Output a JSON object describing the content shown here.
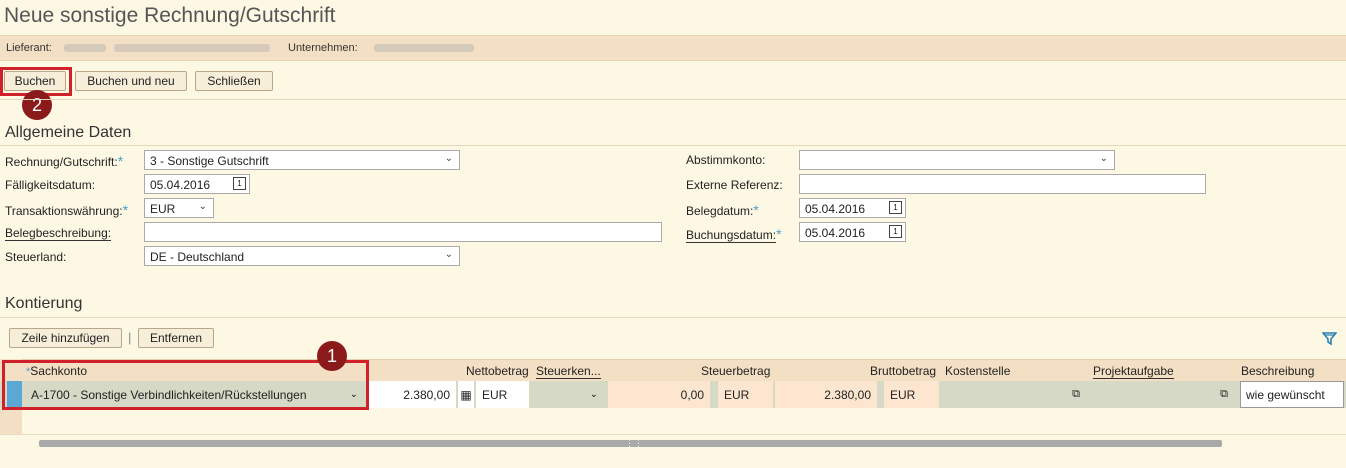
{
  "page": {
    "title": "Neue sonstige Rechnung/Gutschrift"
  },
  "info": {
    "supplier_label": "Lieferant:",
    "company_label": "Unternehmen:"
  },
  "toolbar": {
    "book": "Buchen",
    "book_new": "Buchen und neu",
    "close": "Schließen"
  },
  "callouts": {
    "one": "1",
    "two": "2"
  },
  "general": {
    "heading": "Allgemeine Daten",
    "invoice_type": {
      "label": "Rechnung/Gutschrift:",
      "value": "3 - Sonstige Gutschrift"
    },
    "due_date": {
      "label": "Fälligkeitsdatum:",
      "value": "05.04.2016"
    },
    "currency": {
      "label": "Transaktionswährung:",
      "value": "EUR"
    },
    "description": {
      "label": "Belegbeschreibung:",
      "value": ""
    },
    "tax_country": {
      "label": "Steuerland:",
      "value": "DE - Deutschland"
    },
    "recon_account": {
      "label": "Abstimmkonto:",
      "value": ""
    },
    "external_ref": {
      "label": "Externe Referenz:",
      "value": ""
    },
    "doc_date": {
      "label": "Belegdatum:",
      "value": "05.04.2016"
    },
    "posting_date": {
      "label": "Buchungsdatum:",
      "value": "05.04.2016"
    }
  },
  "accounting": {
    "heading": "Kontierung",
    "add_row": "Zeile hinzufügen",
    "remove": "Entfernen",
    "separator": "|",
    "columns": {
      "gl_account": "Sachkonto",
      "net": "Nettobetrag",
      "tax_code": "Steuerken...",
      "tax_amount": "Steuerbetrag",
      "gross": "Bruttobetrag",
      "cost_center": "Kostenstelle",
      "project_task": "Projektaufgabe",
      "description": "Beschreibung"
    },
    "row": {
      "gl_account": "A-1700 - Sonstige Verbindlichkeiten/Rückstellungen",
      "net": "2.380,00",
      "net_currency": "EUR",
      "tax_amount": "0,00",
      "tax_currency": "EUR",
      "gross": "2.380,00",
      "gross_currency": "EUR",
      "description": "wie gewünscht"
    }
  },
  "colors": {
    "accent": "#4a9fcf",
    "highlight": "#d0202a",
    "callout": "#8b1a1a"
  }
}
